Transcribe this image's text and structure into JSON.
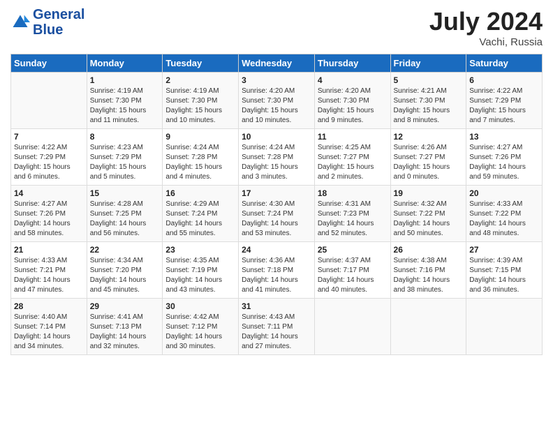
{
  "header": {
    "logo_line1": "General",
    "logo_line2": "Blue",
    "month": "July 2024",
    "location": "Vachi, Russia"
  },
  "days_of_week": [
    "Sunday",
    "Monday",
    "Tuesday",
    "Wednesday",
    "Thursday",
    "Friday",
    "Saturday"
  ],
  "weeks": [
    [
      {
        "day": "",
        "sunrise": "",
        "sunset": "",
        "daylight": ""
      },
      {
        "day": "1",
        "sunrise": "4:19 AM",
        "sunset": "7:30 PM",
        "daylight": "15 hours and 11 minutes."
      },
      {
        "day": "2",
        "sunrise": "4:19 AM",
        "sunset": "7:30 PM",
        "daylight": "15 hours and 10 minutes."
      },
      {
        "day": "3",
        "sunrise": "4:20 AM",
        "sunset": "7:30 PM",
        "daylight": "15 hours and 10 minutes."
      },
      {
        "day": "4",
        "sunrise": "4:20 AM",
        "sunset": "7:30 PM",
        "daylight": "15 hours and 9 minutes."
      },
      {
        "day": "5",
        "sunrise": "4:21 AM",
        "sunset": "7:30 PM",
        "daylight": "15 hours and 8 minutes."
      },
      {
        "day": "6",
        "sunrise": "4:22 AM",
        "sunset": "7:29 PM",
        "daylight": "15 hours and 7 minutes."
      }
    ],
    [
      {
        "day": "7",
        "sunrise": "4:22 AM",
        "sunset": "7:29 PM",
        "daylight": "15 hours and 6 minutes."
      },
      {
        "day": "8",
        "sunrise": "4:23 AM",
        "sunset": "7:29 PM",
        "daylight": "15 hours and 5 minutes."
      },
      {
        "day": "9",
        "sunrise": "4:24 AM",
        "sunset": "7:28 PM",
        "daylight": "15 hours and 4 minutes."
      },
      {
        "day": "10",
        "sunrise": "4:24 AM",
        "sunset": "7:28 PM",
        "daylight": "15 hours and 3 minutes."
      },
      {
        "day": "11",
        "sunrise": "4:25 AM",
        "sunset": "7:27 PM",
        "daylight": "15 hours and 2 minutes."
      },
      {
        "day": "12",
        "sunrise": "4:26 AM",
        "sunset": "7:27 PM",
        "daylight": "15 hours and 0 minutes."
      },
      {
        "day": "13",
        "sunrise": "4:27 AM",
        "sunset": "7:26 PM",
        "daylight": "14 hours and 59 minutes."
      }
    ],
    [
      {
        "day": "14",
        "sunrise": "4:27 AM",
        "sunset": "7:26 PM",
        "daylight": "14 hours and 58 minutes."
      },
      {
        "day": "15",
        "sunrise": "4:28 AM",
        "sunset": "7:25 PM",
        "daylight": "14 hours and 56 minutes."
      },
      {
        "day": "16",
        "sunrise": "4:29 AM",
        "sunset": "7:24 PM",
        "daylight": "14 hours and 55 minutes."
      },
      {
        "day": "17",
        "sunrise": "4:30 AM",
        "sunset": "7:24 PM",
        "daylight": "14 hours and 53 minutes."
      },
      {
        "day": "18",
        "sunrise": "4:31 AM",
        "sunset": "7:23 PM",
        "daylight": "14 hours and 52 minutes."
      },
      {
        "day": "19",
        "sunrise": "4:32 AM",
        "sunset": "7:22 PM",
        "daylight": "14 hours and 50 minutes."
      },
      {
        "day": "20",
        "sunrise": "4:33 AM",
        "sunset": "7:22 PM",
        "daylight": "14 hours and 48 minutes."
      }
    ],
    [
      {
        "day": "21",
        "sunrise": "4:33 AM",
        "sunset": "7:21 PM",
        "daylight": "14 hours and 47 minutes."
      },
      {
        "day": "22",
        "sunrise": "4:34 AM",
        "sunset": "7:20 PM",
        "daylight": "14 hours and 45 minutes."
      },
      {
        "day": "23",
        "sunrise": "4:35 AM",
        "sunset": "7:19 PM",
        "daylight": "14 hours and 43 minutes."
      },
      {
        "day": "24",
        "sunrise": "4:36 AM",
        "sunset": "7:18 PM",
        "daylight": "14 hours and 41 minutes."
      },
      {
        "day": "25",
        "sunrise": "4:37 AM",
        "sunset": "7:17 PM",
        "daylight": "14 hours and 40 minutes."
      },
      {
        "day": "26",
        "sunrise": "4:38 AM",
        "sunset": "7:16 PM",
        "daylight": "14 hours and 38 minutes."
      },
      {
        "day": "27",
        "sunrise": "4:39 AM",
        "sunset": "7:15 PM",
        "daylight": "14 hours and 36 minutes."
      }
    ],
    [
      {
        "day": "28",
        "sunrise": "4:40 AM",
        "sunset": "7:14 PM",
        "daylight": "14 hours and 34 minutes."
      },
      {
        "day": "29",
        "sunrise": "4:41 AM",
        "sunset": "7:13 PM",
        "daylight": "14 hours and 32 minutes."
      },
      {
        "day": "30",
        "sunrise": "4:42 AM",
        "sunset": "7:12 PM",
        "daylight": "14 hours and 30 minutes."
      },
      {
        "day": "31",
        "sunrise": "4:43 AM",
        "sunset": "7:11 PM",
        "daylight": "14 hours and 27 minutes."
      },
      {
        "day": "",
        "sunrise": "",
        "sunset": "",
        "daylight": ""
      },
      {
        "day": "",
        "sunrise": "",
        "sunset": "",
        "daylight": ""
      },
      {
        "day": "",
        "sunrise": "",
        "sunset": "",
        "daylight": ""
      }
    ]
  ],
  "labels": {
    "sunrise_prefix": "Sunrise: ",
    "sunset_prefix": "Sunset: ",
    "daylight_prefix": "Daylight: "
  }
}
